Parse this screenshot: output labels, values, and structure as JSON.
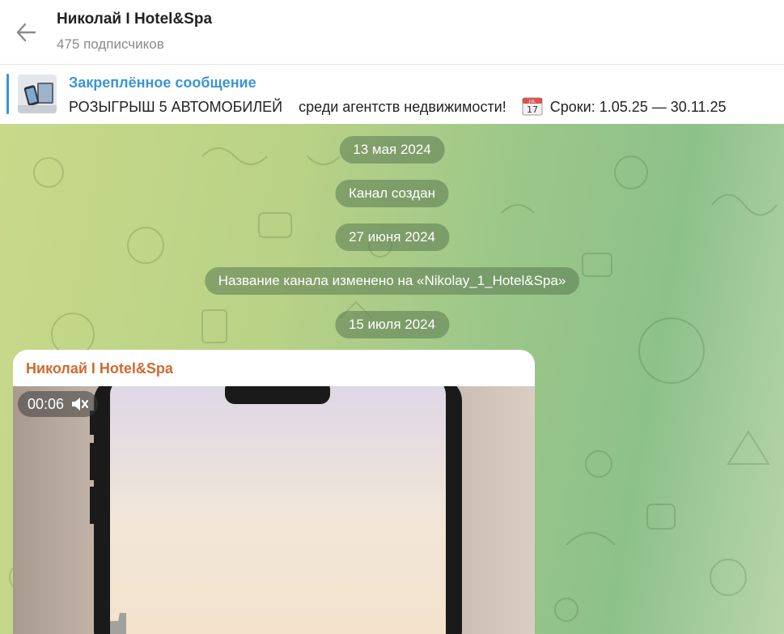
{
  "header": {
    "title": "Николай I Hotel&Spa",
    "subscribers": "475 подписчиков"
  },
  "pinned": {
    "title": "Закреплённое сообщение",
    "text_part1": "РОЗЫГРЫШ 5 АВТОМОБИЛЕЙ    среди агентств недвижимости!",
    "calendar_day": "17",
    "calendar_month": "JUL",
    "text_part2": "Сроки: 1.05.25 — 30.11.25"
  },
  "service_messages": [
    "13 мая 2024",
    "Канал создан",
    "27 июня 2024",
    "Название канала изменено на «Nikolay_1_Hotel&Spa»",
    "15 июля 2024"
  ],
  "message": {
    "author": "Николай I Hotel&Spa",
    "video_duration": "00:06",
    "muted_icon": "speaker-muted-icon"
  },
  "colors": {
    "accent": "#3a95d5",
    "author": "#cf6a2f",
    "service_bubble": "#5a7850"
  }
}
